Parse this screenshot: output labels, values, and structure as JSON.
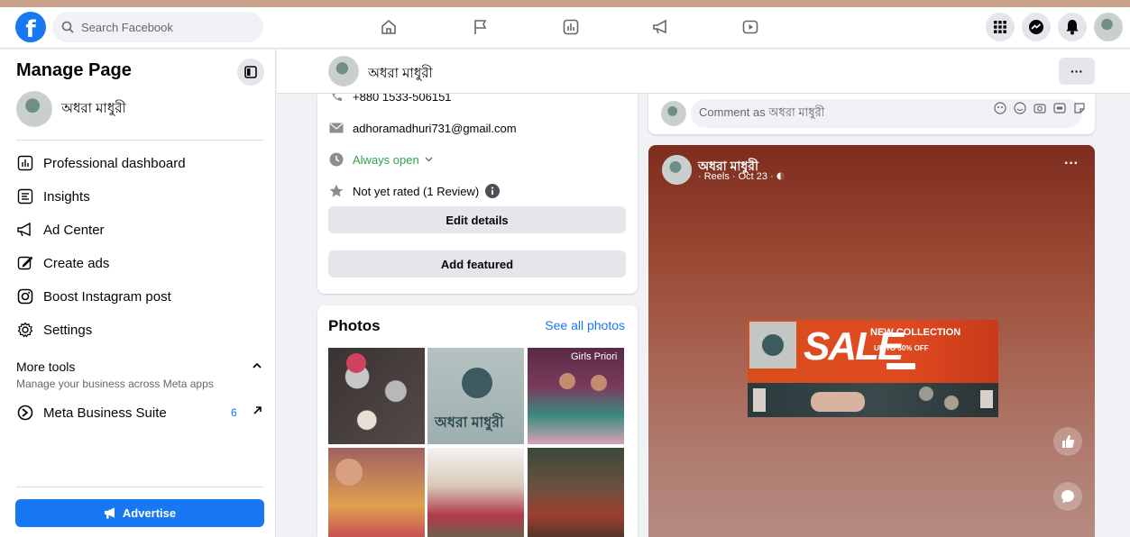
{
  "topbar": {
    "search_placeholder": "Search Facebook",
    "brand_color": "#1877f2"
  },
  "sidebar": {
    "title": "Manage Page",
    "page_name": "অধরা মাধুরী",
    "items": [
      {
        "label": "Professional dashboard",
        "icon": "dashboard-icon"
      },
      {
        "label": "Insights",
        "icon": "insights-icon"
      },
      {
        "label": "Ad Center",
        "icon": "megaphone-icon"
      },
      {
        "label": "Create ads",
        "icon": "pencil-icon"
      },
      {
        "label": "Boost Instagram post",
        "icon": "instagram-icon"
      },
      {
        "label": "Settings",
        "icon": "gear-icon"
      }
    ],
    "more_tools": {
      "title": "More tools",
      "subtitle": "Manage your business across Meta apps"
    },
    "meta_business_suite": {
      "label": "Meta Business Suite",
      "badge": "6"
    },
    "advertise_label": "Advertise"
  },
  "page_header": {
    "page_name": "অধরা মাধুরী",
    "more_label": "···"
  },
  "intro": {
    "phone": "+880 1533-506151",
    "email": "adhoramadhuri731@gmail.com",
    "hours": "Always open",
    "rating": "Not yet rated (1 Review)",
    "edit_details": "Edit details",
    "add_featured": "Add featured"
  },
  "photos": {
    "title": "Photos",
    "see_all": "See all photos",
    "tile2_text": "অধরা মাধুরী",
    "tile3_text": "Girls Priori"
  },
  "comment": {
    "placeholder": "Comment as অধরা মাধুরী"
  },
  "reel": {
    "page_name": "অধরা মাধুরী",
    "meta": "· Reels · Oct 23 ·",
    "more": "···",
    "banner": {
      "sale": "SALE",
      "headline": "NEW COLLECTION",
      "discount": "UP TO 50% OFF"
    }
  }
}
